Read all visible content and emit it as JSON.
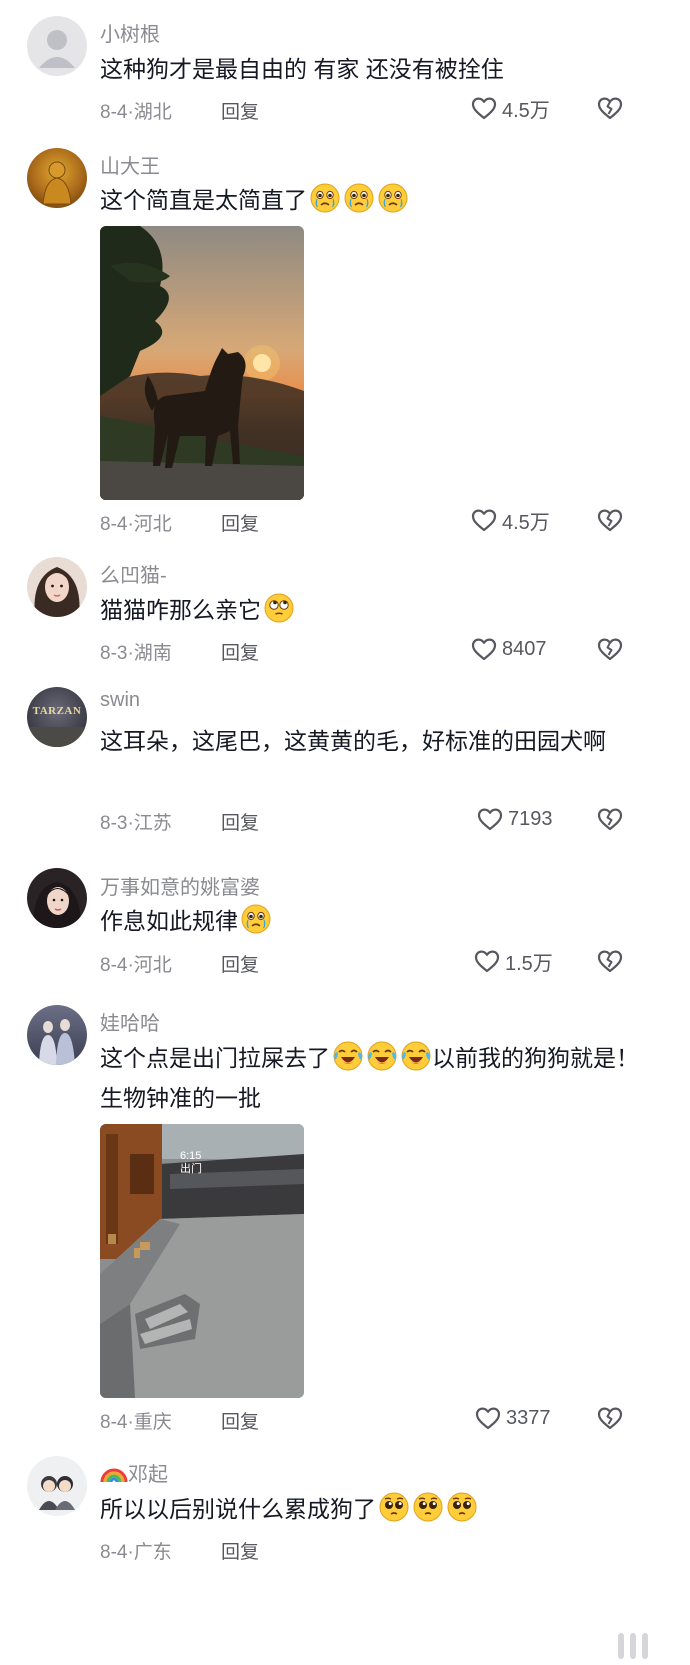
{
  "comments": [
    {
      "username": "小树根",
      "text": "这种狗才是最自由的  有家  还没有被拴住",
      "date": "8-4",
      "location": "湖北",
      "reply_label": "回复",
      "likes": "4.5万",
      "avatar_icon": "default-user-avatar"
    },
    {
      "username": "山大王",
      "text": "这个简直是太简直了",
      "emoji_icons": [
        "crying-face-emoji",
        "crying-face-emoji",
        "crying-face-emoji"
      ],
      "has_photo": true,
      "photo_icon": "dog-sunset-photo",
      "date": "8-4",
      "location": "河北",
      "reply_label": "回复",
      "likes": "4.5万"
    },
    {
      "username": "么凹猫-",
      "text": "猫猫咋那么亲它",
      "emoji_icons": [
        "rolling-eyes-emoji"
      ],
      "date": "8-3",
      "location": "湖南",
      "reply_label": "回复",
      "likes": "8407"
    },
    {
      "username": "swin",
      "text": "这耳朵，这尾巴，这黄黄的毛，好标准的田园犬啊",
      "avatar_text": "TARZAN",
      "date": "8-3",
      "location": "江苏",
      "reply_label": "回复",
      "likes": "7193"
    },
    {
      "username": "万事如意的姚富婆",
      "text": "作息如此规律",
      "emoji_icons": [
        "crying-face-emoji"
      ],
      "date": "8-4",
      "location": "河北",
      "reply_label": "回复",
      "likes": "1.5万"
    },
    {
      "username": "娃哈哈",
      "text_before": "这个点是出门拉屎去了",
      "emoji_icons": [
        "laughing-tears-emoji",
        "laughing-tears-emoji",
        "laughing-tears-emoji"
      ],
      "text_after": "以前我的狗狗就是！生物钟准的一批",
      "has_photo": true,
      "photo_icon": "security-camera-photo",
      "photo_caption": "6:15\n出门",
      "date": "8-4",
      "location": "重庆",
      "reply_label": "回复",
      "likes": "3377"
    },
    {
      "username": "邓起",
      "username_prefix_icon": "rainbow-icon",
      "text": "所以以后别说什么累成狗了",
      "emoji_icons": [
        "pleading-face-emoji",
        "pleading-face-emoji",
        "pleading-face-emoji"
      ],
      "date": "8-4",
      "location": "广东",
      "reply_label": "回复"
    }
  ],
  "colors": {
    "text": "#161823",
    "meta": "#8a8b91",
    "action": "#57585f"
  }
}
